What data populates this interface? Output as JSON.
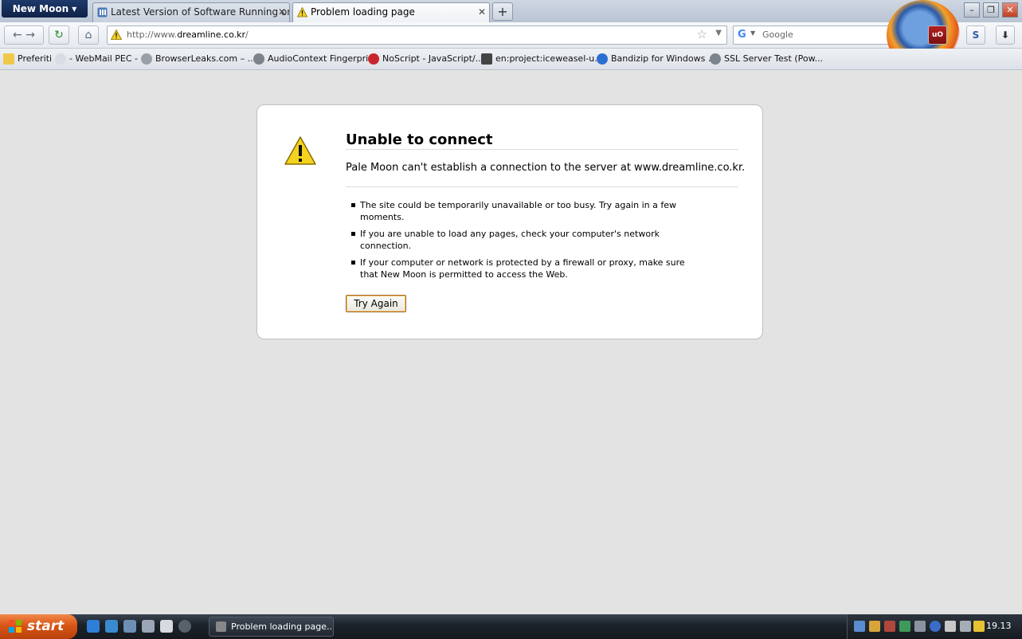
{
  "browser": {
    "app_menu_label": "New Moon ▾",
    "tabs": [
      {
        "label": "Latest Version of Software Running on XP...",
        "close": "✕",
        "active": false
      },
      {
        "label": "Problem loading page",
        "close": "✕",
        "active": true
      }
    ],
    "new_tab": "+",
    "window_controls": {
      "minimize": "–",
      "restore": "❐",
      "close": "✕"
    },
    "nav": {
      "back": "←",
      "forward": "→",
      "reload": "↻",
      "home": "⌂"
    },
    "url": {
      "prefix": "http://www.",
      "domain": "dreamline.co.kr",
      "suffix": "/"
    },
    "bookmark_star": "☆",
    "url_dropdown": "▼",
    "search": {
      "engine_glyph": "G",
      "engine_dropdown": "▼",
      "placeholder": "Google",
      "go": "⌕"
    },
    "extensions": [
      {
        "label": "uO",
        "name": "ublock-origin-icon",
        "color": "#8b1a1a"
      },
      {
        "label": "S",
        "name": "s-extension-icon",
        "color": "#2e5aa8"
      },
      {
        "label": "⬇",
        "name": "download-icon",
        "color": "#333333"
      }
    ],
    "bookmarks": [
      {
        "label": "Preferiti",
        "name": "bookmark-folder-preferiti"
      },
      {
        "label": "- WebMail PEC -",
        "name": "bookmark-webmail-pec"
      },
      {
        "label": "BrowserLeaks.com – ...",
        "name": "bookmark-browserleaks"
      },
      {
        "label": "AudioContext Fingerpri...",
        "name": "bookmark-audiocontext"
      },
      {
        "label": "NoScript - JavaScript/...",
        "name": "bookmark-noscript"
      },
      {
        "label": "en:project:iceweasel-u...",
        "name": "bookmark-iceweasel"
      },
      {
        "label": "Bandizip for Windows ...",
        "name": "bookmark-bandizip"
      },
      {
        "label": "SSL Server Test (Pow...",
        "name": "bookmark-ssl-server-test"
      }
    ]
  },
  "error_page": {
    "title": "Unable to connect",
    "message": "Pale Moon can't establish a connection to the server at www.dreamline.co.kr.",
    "bullets": [
      "The site could be temporarily unavailable or too busy. Try again in a few moments.",
      "If you are unable to load any pages, check your computer's network connection.",
      "If your computer or network is protected by a firewall or proxy, make sure that New Moon is permitted to access the Web."
    ],
    "try_again_label": "Try Again",
    "warning_glyph": "!"
  },
  "taskbar": {
    "start_label": "start",
    "task_button_label": "Problem loading page...",
    "clock": "19.13"
  },
  "colors": {
    "error_bg": "#e3e3e3",
    "panel_bg": "#ffffff",
    "warning_yellow": "#f4d21f",
    "start_orange": "#d85516"
  }
}
